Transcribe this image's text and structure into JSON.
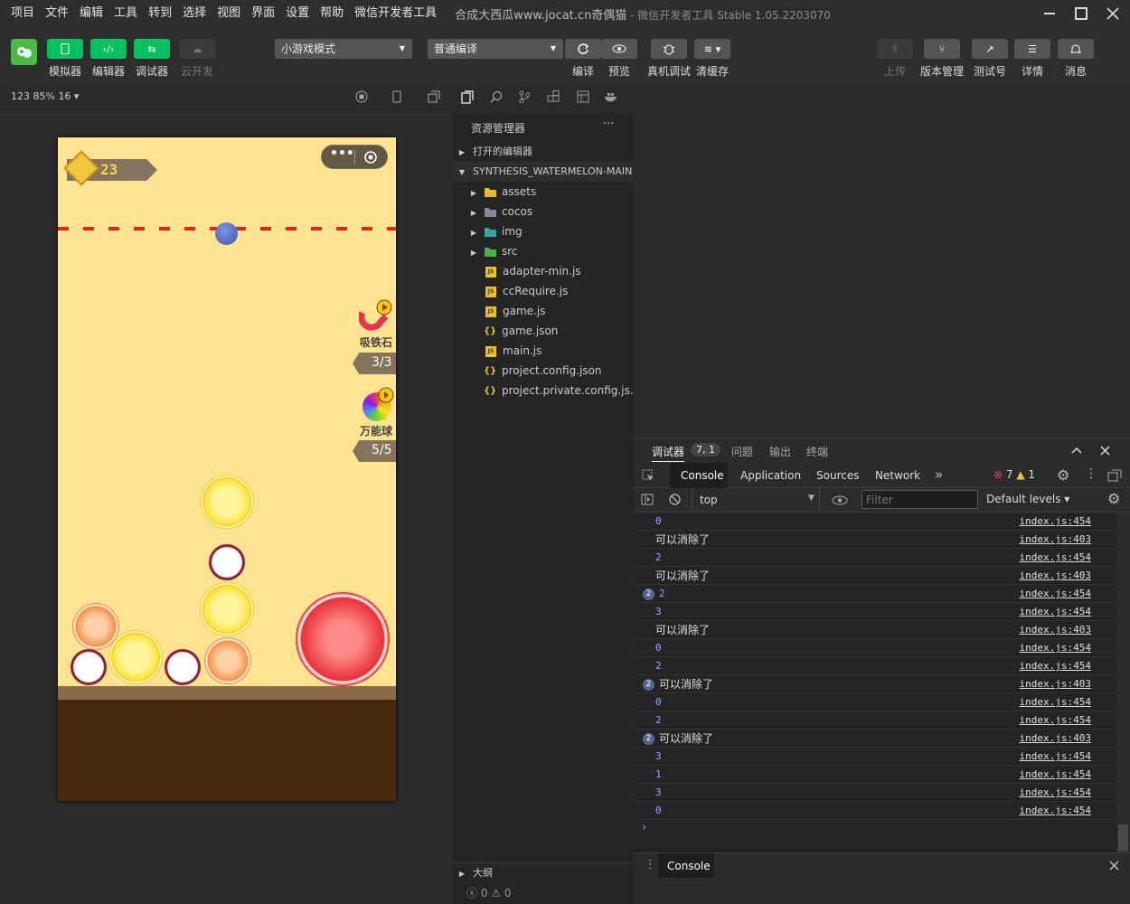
{
  "menu": [
    "项目",
    "文件",
    "编辑",
    "工具",
    "转到",
    "选择",
    "视图",
    "界面",
    "设置",
    "帮助",
    "微信开发者工具"
  ],
  "title": {
    "main": "合成大西瓜www.jocat.cn奇偶猫",
    "sub": " - 微信开发者工具 Stable 1.05.2203070"
  },
  "toolbar": {
    "simulator": "模拟器",
    "editor": "编辑器",
    "debugger": "调试器",
    "cloud": "云开发",
    "mode": "小游戏模式",
    "compile_mode": "普通编译",
    "compile": "编译",
    "preview": "预览",
    "device_debug": "真机调试",
    "clear_cache": "清缓存",
    "upload": "上传",
    "version": "版本管理",
    "test": "测试号",
    "details": "详情",
    "messages": "消息"
  },
  "sim": {
    "zoom": "123 85% 16 ▾"
  },
  "game": {
    "score": "23",
    "magnet_label": "吸铁石",
    "magnet_count": "3/3",
    "rainbow_label": "万能球",
    "rainbow_count": "5/5"
  },
  "explorer": {
    "title": "资源管理器",
    "more": "···",
    "open_editors": "打开的编辑器",
    "project": "SYNTHESIS_WATERMELON-MAIN",
    "folders": [
      "assets",
      "cocos",
      "img",
      "src"
    ],
    "files": [
      {
        "name": "adapter-min.js",
        "type": "js"
      },
      {
        "name": "ccRequire.js",
        "type": "js"
      },
      {
        "name": "game.js",
        "type": "js"
      },
      {
        "name": "game.json",
        "type": "json"
      },
      {
        "name": "main.js",
        "type": "js"
      },
      {
        "name": "project.config.json",
        "type": "json"
      },
      {
        "name": "project.private.config.js...",
        "type": "json"
      }
    ],
    "outline": "大纲",
    "status_errors": "0",
    "status_warnings": "0"
  },
  "devtools": {
    "tabs": [
      "调试器",
      "7, 1",
      "问题",
      "输出",
      "终端"
    ],
    "subtabs": [
      "Console",
      "Application",
      "Sources",
      "Network"
    ],
    "more": "»",
    "errors": "7",
    "warnings": "1",
    "context": "top",
    "filter_placeholder": "Filter",
    "levels": "Default levels ▾",
    "drawer_tab": "Console",
    "prompt": "›"
  },
  "console": [
    {
      "v": "0",
      "src": "index.js:454"
    },
    {
      "t": "可以消除了",
      "src": "index.js:403"
    },
    {
      "v": "2",
      "src": "index.js:454"
    },
    {
      "t": "可以消除了",
      "src": "index.js:403"
    },
    {
      "v": "2",
      "src": "index.js:454",
      "n": "2"
    },
    {
      "v": "3",
      "src": "index.js:454"
    },
    {
      "t": "可以消除了",
      "src": "index.js:403"
    },
    {
      "v": "0",
      "src": "index.js:454"
    },
    {
      "v": "2",
      "src": "index.js:454"
    },
    {
      "t": "可以消除了",
      "src": "index.js:403",
      "n": "2"
    },
    {
      "v": "0",
      "src": "index.js:454"
    },
    {
      "v": "2",
      "src": "index.js:454"
    },
    {
      "t": "可以消除了",
      "src": "index.js:403",
      "n": "2"
    },
    {
      "v": "3",
      "src": "index.js:454"
    },
    {
      "v": "1",
      "src": "index.js:454"
    },
    {
      "v": "3",
      "src": "index.js:454"
    },
    {
      "v": "0",
      "src": "index.js:454"
    }
  ],
  "colors": {
    "accent": "#07c160",
    "danger_line": "#e8231c",
    "error": "#e84545",
    "warning": "#f0c24b"
  }
}
